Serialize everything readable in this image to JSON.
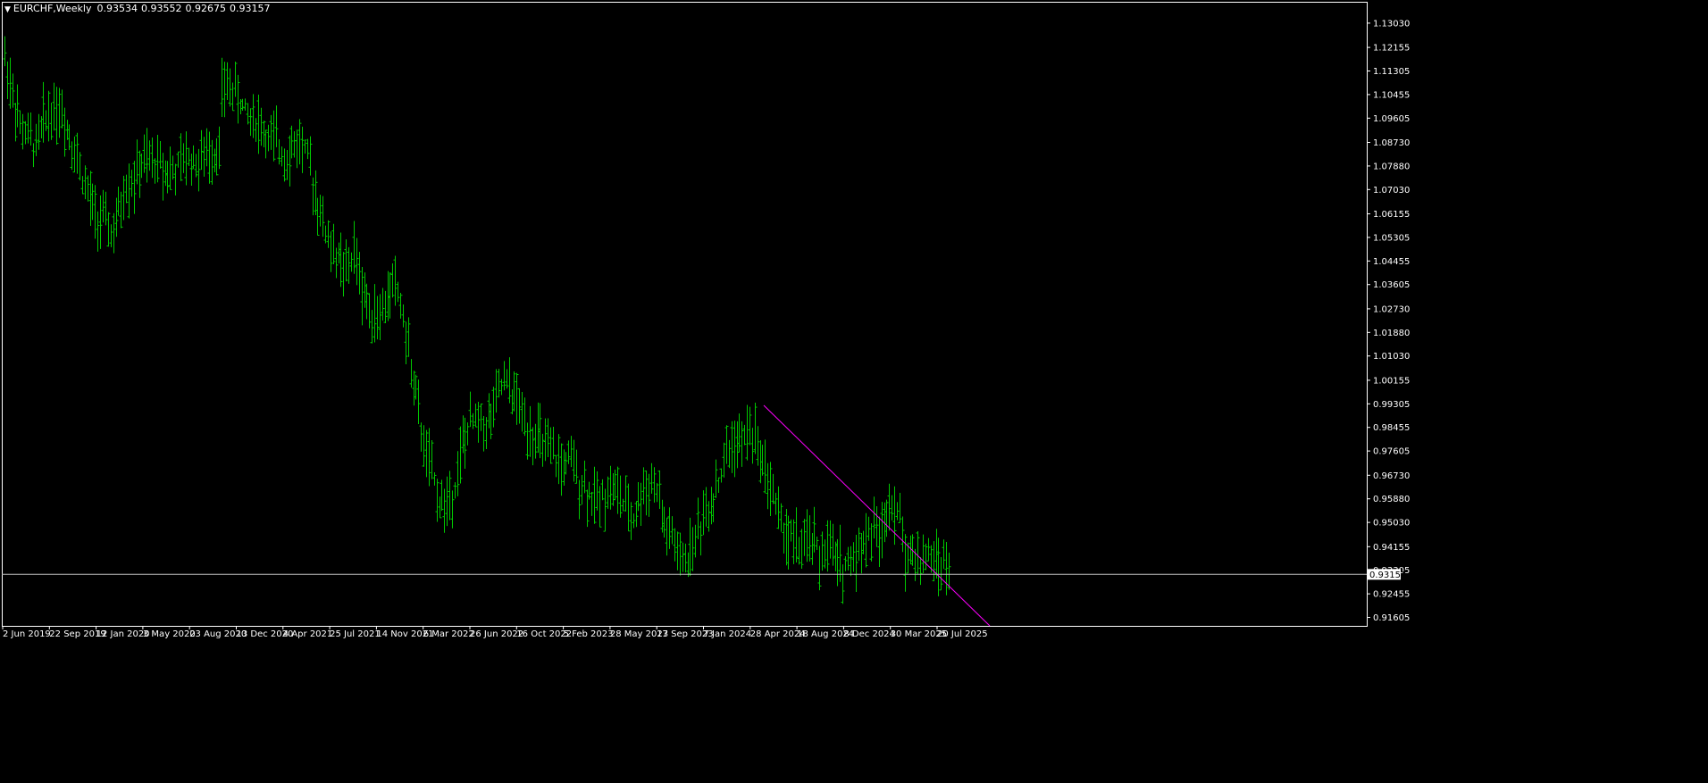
{
  "header": {
    "symbol": "EURCHF,Weekly",
    "ohlc": [
      "0.93534",
      "0.93552",
      "0.92675",
      "0.93157"
    ]
  },
  "chart_data": {
    "type": "ohlc",
    "symbol": "EURCHF",
    "timeframe": "Weekly",
    "ylim": [
      0.913,
      1.138
    ],
    "y_ticks": [
      "1.13030",
      "1.12155",
      "1.11305",
      "1.10455",
      "1.09605",
      "1.08730",
      "1.07880",
      "1.07030",
      "1.06155",
      "1.05305",
      "1.04455",
      "1.03605",
      "1.02730",
      "1.01880",
      "1.01030",
      "1.00155",
      "0.99305",
      "0.98455",
      "0.97605",
      "0.96730",
      "0.95880",
      "0.95030",
      "0.94155",
      "0.93305",
      "0.92455",
      "0.91605"
    ],
    "x_ticks": [
      "2 Jun 2019",
      "22 Sep 2019",
      "12 Jan 2020",
      "3 May 2020",
      "23 Aug 2020",
      "13 Dec 2020",
      "4 Apr 2021",
      "25 Jul 2021",
      "14 Nov 2021",
      "6 Mar 2022",
      "26 Jun 2022",
      "16 Oct 2022",
      "5 Feb 2023",
      "28 May 2023",
      "17 Sep 2023",
      "7 Jan 2024",
      "28 Apr 2024",
      "18 Aug 2024",
      "8 Dec 2024",
      "30 Mar 2025",
      "20 Jul 2025"
    ],
    "current_price": "0.93157",
    "trendline": {
      "from": [
        "2024-05",
        0.992
      ],
      "to": [
        "2025-09",
        0.913
      ],
      "color": "#FF00FF"
    },
    "bar_color": "#00C800",
    "price_line_color": "#C0C0C0",
    "background": "#000000",
    "anchors": [
      [
        0,
        1.118
      ],
      [
        3,
        1.105
      ],
      [
        6,
        1.093
      ],
      [
        9,
        1.089
      ],
      [
        12,
        1.086
      ],
      [
        15,
        1.095
      ],
      [
        18,
        1.099
      ],
      [
        21,
        1.1
      ],
      [
        24,
        1.093
      ],
      [
        27,
        1.085
      ],
      [
        30,
        1.075
      ],
      [
        33,
        1.066
      ],
      [
        36,
        1.06
      ],
      [
        39,
        1.058
      ],
      [
        42,
        1.054
      ],
      [
        45,
        1.065
      ],
      [
        47,
        1.072
      ],
      [
        50,
        1.074
      ],
      [
        53,
        1.079
      ],
      [
        56,
        1.08
      ],
      [
        59,
        1.081
      ],
      [
        62,
        1.078
      ],
      [
        65,
        1.076
      ],
      [
        68,
        1.079
      ],
      [
        71,
        1.082
      ],
      [
        74,
        1.08
      ],
      [
        77,
        1.081
      ],
      [
        80,
        1.084
      ],
      [
        83,
        1.085
      ],
      [
        84,
        1.105
      ],
      [
        87,
        1.108
      ],
      [
        90,
        1.104
      ],
      [
        93,
        1.098
      ],
      [
        96,
        1.097
      ],
      [
        99,
        1.093
      ],
      [
        102,
        1.088
      ],
      [
        105,
        1.087
      ],
      [
        108,
        1.083
      ],
      [
        111,
        1.085
      ],
      [
        114,
        1.088
      ],
      [
        117,
        1.081
      ],
      [
        120,
        1.07
      ],
      [
        123,
        1.058
      ],
      [
        126,
        1.05
      ],
      [
        129,
        1.045
      ],
      [
        132,
        1.04
      ],
      [
        135,
        1.048
      ],
      [
        138,
        1.035
      ],
      [
        141,
        1.028
      ],
      [
        144,
        1.025
      ],
      [
        147,
        1.027
      ],
      [
        150,
        1.038
      ],
      [
        153,
        1.03
      ],
      [
        156,
        1.012
      ],
      [
        159,
        0.995
      ],
      [
        162,
        0.978
      ],
      [
        165,
        0.968
      ],
      [
        168,
        0.958
      ],
      [
        171,
        0.957
      ],
      [
        174,
        0.965
      ],
      [
        177,
        0.978
      ],
      [
        180,
        0.985
      ],
      [
        183,
        0.988
      ],
      [
        186,
        0.986
      ],
      [
        189,
        0.99
      ],
      [
        192,
        1.0
      ],
      [
        195,
        0.998
      ],
      [
        198,
        0.994
      ],
      [
        201,
        0.987
      ],
      [
        204,
        0.983
      ],
      [
        207,
        0.98
      ],
      [
        210,
        0.975
      ],
      [
        213,
        0.973
      ],
      [
        216,
        0.97
      ],
      [
        219,
        0.972
      ],
      [
        222,
        0.966
      ],
      [
        225,
        0.962
      ],
      [
        228,
        0.958
      ],
      [
        231,
        0.96
      ],
      [
        234,
        0.963
      ],
      [
        237,
        0.961
      ],
      [
        240,
        0.955
      ],
      [
        243,
        0.952
      ],
      [
        246,
        0.96
      ],
      [
        249,
        0.965
      ],
      [
        252,
        0.963
      ],
      [
        255,
        0.948
      ],
      [
        258,
        0.945
      ],
      [
        261,
        0.935
      ],
      [
        264,
        0.938
      ],
      [
        267,
        0.945
      ],
      [
        270,
        0.952
      ],
      [
        273,
        0.958
      ],
      [
        276,
        0.965
      ],
      [
        279,
        0.975
      ],
      [
        282,
        0.98
      ],
      [
        285,
        0.978
      ],
      [
        288,
        0.985
      ],
      [
        291,
        0.978
      ],
      [
        294,
        0.97
      ],
      [
        297,
        0.96
      ],
      [
        300,
        0.95
      ],
      [
        303,
        0.945
      ],
      [
        306,
        0.943
      ],
      [
        309,
        0.94
      ],
      [
        312,
        0.945
      ],
      [
        315,
        0.938
      ],
      [
        318,
        0.941
      ],
      [
        321,
        0.938
      ],
      [
        324,
        0.934
      ],
      [
        327,
        0.937
      ],
      [
        330,
        0.941
      ],
      [
        333,
        0.945
      ],
      [
        336,
        0.948
      ],
      [
        339,
        0.946
      ],
      [
        342,
        0.96
      ],
      [
        345,
        0.955
      ],
      [
        348,
        0.94
      ],
      [
        351,
        0.938
      ],
      [
        354,
        0.936
      ],
      [
        357,
        0.938
      ],
      [
        360,
        0.936
      ],
      [
        363,
        0.935
      ],
      [
        365,
        0.932
      ]
    ]
  }
}
